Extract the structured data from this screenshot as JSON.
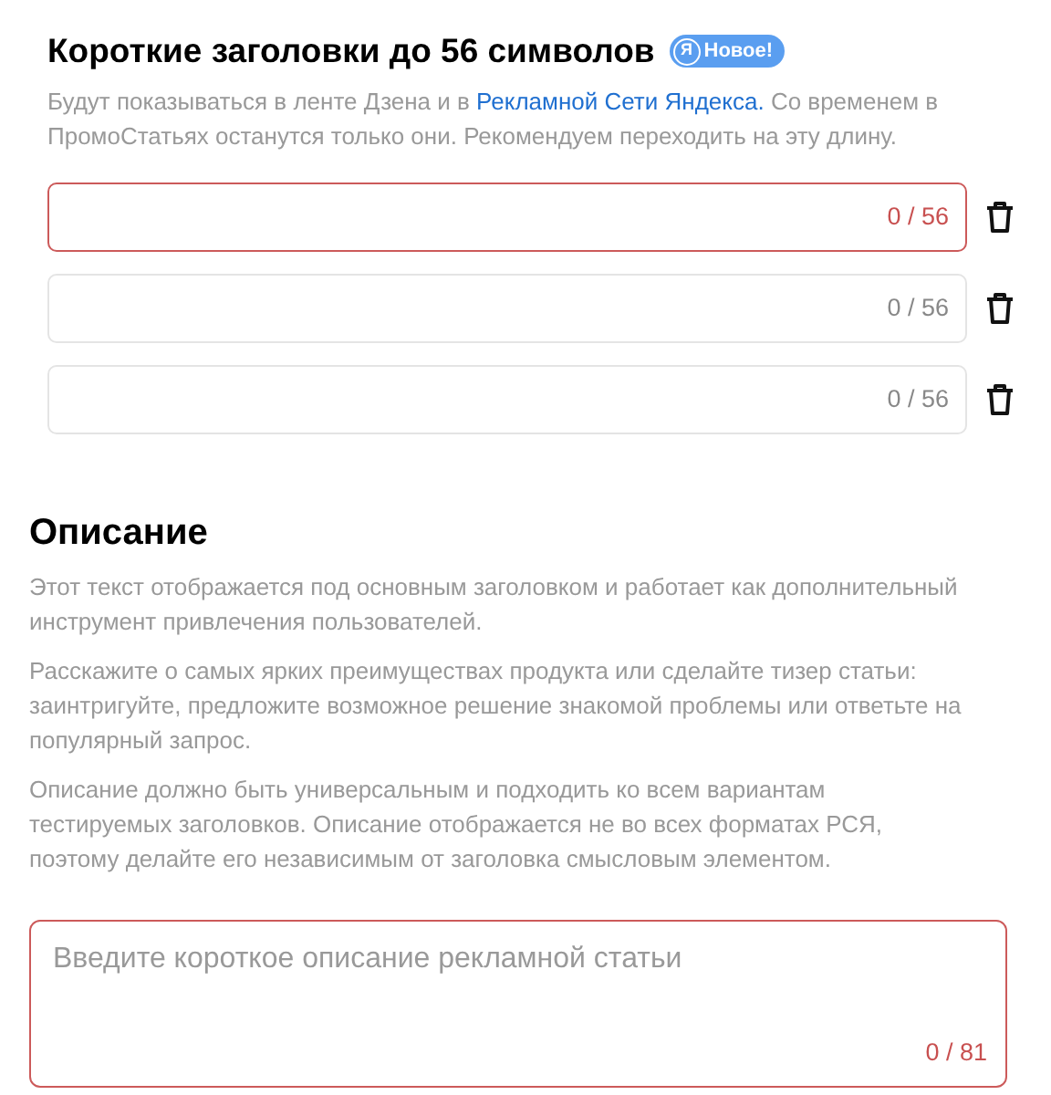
{
  "headlines": {
    "title": "Короткие заголовки до 56 символов",
    "badge": {
      "logo": "Я",
      "label": "Новое!"
    },
    "description": {
      "before": "Будут показываться в ленте Дзена и в ",
      "link": "Рекламной Сети Яндекса.",
      "after": " Со временем в ПромоСтатьях останутся только они. Рекомендуем переходить на эту длину."
    },
    "fields": [
      {
        "counter": "0 / 56",
        "error": true
      },
      {
        "counter": "0 / 56",
        "error": false
      },
      {
        "counter": "0 / 56",
        "error": false
      }
    ]
  },
  "description_section": {
    "title": "Описание",
    "paragraphs": [
      "Этот текст отображается под основным заголовком и работает как дополнительный инструмент привлечения пользователей.",
      "Расскажите о самых ярких преимуществах продукта или сделайте тизер статьи: заинтригуйте, предложите возможное решение знакомой проблемы или ответьте на популярный запрос.",
      "Описание должно быть универсальным и подходить ко всем вариантам тестируемых заголовков. Описание отображается не во всех форматах РСЯ, поэтому делайте его независимым от заголовка смысловым элементом."
    ],
    "field": {
      "placeholder": "Введите короткое описание рекламной статьи",
      "counter": "0 / 81",
      "error": true
    }
  }
}
